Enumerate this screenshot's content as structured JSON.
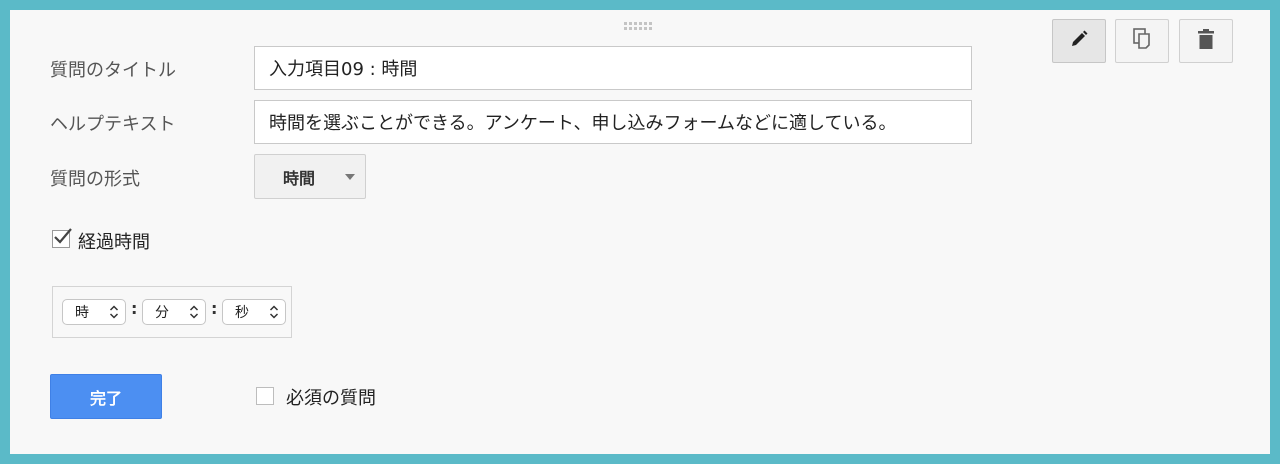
{
  "toolbar": {
    "edit_icon": "pencil-icon",
    "duplicate_icon": "duplicate-icon",
    "delete_icon": "trash-icon"
  },
  "form": {
    "title_label": "質問のタイトル",
    "title_value": "入力項目09 : 時間",
    "help_label": "ヘルプテキスト",
    "help_value": "時間を選ぶことができる。アンケート、申し込みフォームなどに適している。",
    "type_label": "質問の形式",
    "type_value": "時間",
    "duration_label": "経過時間",
    "duration_checked": true,
    "time": {
      "hour": "時",
      "minute": "分",
      "second": "秒",
      "separator": ":"
    },
    "done_label": "完了",
    "required_label": "必須の質問",
    "required_checked": false
  },
  "colors": {
    "border_accent": "#5bbac8",
    "panel_bg": "#f8f8f8",
    "primary_button": "#4c8ff2"
  }
}
